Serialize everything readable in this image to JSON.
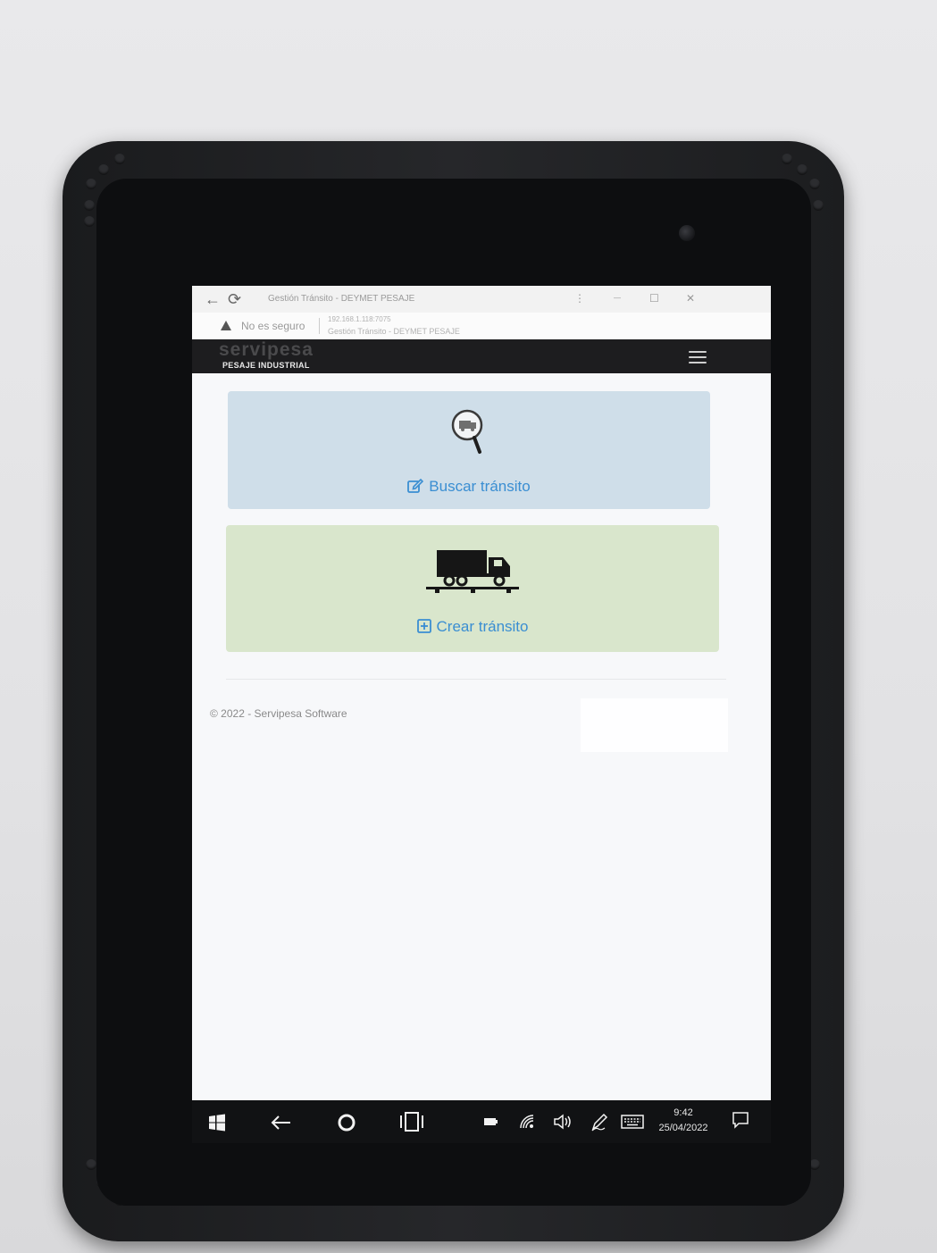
{
  "browser": {
    "tab_title": "Gestión Tránsito - DEYMET PESAJE",
    "security_label": "No es seguro",
    "url": "192.168.1.118:7075",
    "page_title": "Gestión Tránsito - DEYMET PESAJE",
    "menu_glyph": "⋮",
    "minimize_glyph": "—",
    "maximize_glyph": "☐",
    "close_glyph": "✕"
  },
  "site": {
    "logo_text": "servipesa",
    "logo_subtitle": "PESAJE INDUSTRIAL",
    "menu_icon": "hamburger-icon"
  },
  "cards": {
    "search": {
      "label": "Buscar tránsito",
      "icon": "truck-magnifier-icon",
      "label_icon": "edit-icon",
      "color": "#cfdee9"
    },
    "create": {
      "label": "Crear tránsito",
      "icon": "truck-on-scale-icon",
      "label_icon": "plus-square-icon",
      "color": "#d9e6cc"
    }
  },
  "footer": {
    "text": "© 2022 - Servipesa Software"
  },
  "taskbar": {
    "time": "9:42",
    "date": "25/04/2022",
    "icons": [
      "windows-start-icon",
      "back-arrow-icon",
      "cortana-icon",
      "task-view-icon",
      "battery-icon",
      "wifi-icon",
      "volume-icon",
      "pen-icon",
      "keyboard-icon",
      "notifications-icon"
    ]
  },
  "colors": {
    "link": "#3a8ed2",
    "navbar": "#1d1d1f"
  }
}
